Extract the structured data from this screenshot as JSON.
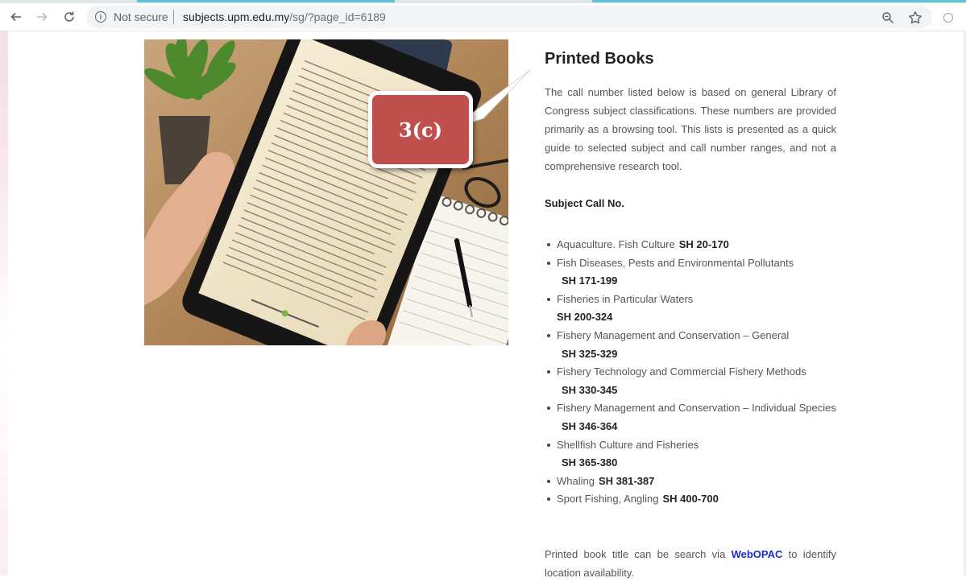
{
  "browser": {
    "security_label": "Not secure",
    "url_host": "subjects.upm.edu.my",
    "url_path": "/sg/?page_id=6189",
    "icons": [
      "back-arrow-icon",
      "forward-arrow-icon",
      "reload-icon",
      "info-icon",
      "zoom-icon",
      "star-icon",
      "extension-icon"
    ]
  },
  "page": {
    "title": "Printed Books",
    "intro": "The call number listed below is based on general Library of Congress subject classifications. These numbers are provided primarily as a browsing tool. This lists is presented as a quick guide to selected subject and call number ranges, and not a comprehensive research tool.",
    "subject_heading": "Subject Call No.",
    "subjects": [
      {
        "name": "Aquaculture. Fish Culture",
        "code": "SH 20-170"
      },
      {
        "name": "Fish Diseases, Pests and Environmental Pollutants",
        "code": "SH 171-199"
      },
      {
        "name": "Fisheries in Particular Waters",
        "code": "SH 200-324"
      },
      {
        "name": "Fishery Management and Conservation – General",
        "code": "SH 325-329"
      },
      {
        "name": "Fishery Technology and Commercial Fishery Methods",
        "code": "SH 330-345"
      },
      {
        "name": "Fishery Management and Conservation – Individual Species",
        "code": "SH 346-364"
      },
      {
        "name": "Shellfish Culture and Fisheries",
        "code": "SH 365-380"
      },
      {
        "name": "Whaling",
        "code": "SH 381-387"
      },
      {
        "name": "Sport Fishing, Angling",
        "code": "SH 400-700"
      }
    ],
    "footer_before": "Printed book title can be search via",
    "footer_link": "WebOPAC",
    "footer_after": "to identify location availability."
  },
  "callout": {
    "label": "3(c)",
    "color": "#c0504d"
  },
  "colors": {
    "accent_tab": "#5fc6cf",
    "link": "#1e2ad8"
  }
}
